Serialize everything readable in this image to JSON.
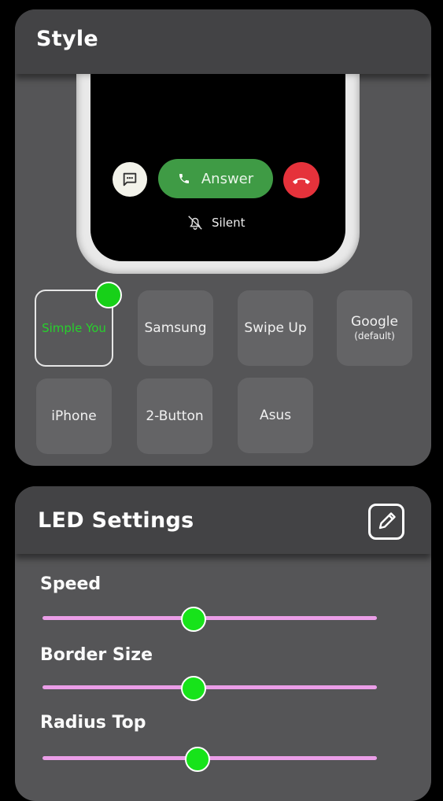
{
  "style_card": {
    "title": "Style",
    "preview": {
      "answer_label": "Answer",
      "silent_label": "Silent",
      "colors": {
        "answer": "#3f9b45",
        "decline": "#e5323b"
      }
    },
    "options": [
      {
        "label": "Simple You",
        "selected": true
      },
      {
        "label": "Samsung"
      },
      {
        "label": "Swipe Up"
      },
      {
        "label": "Google",
        "sublabel": "(default)"
      },
      {
        "label": "iPhone"
      },
      {
        "label": "2-Button"
      },
      {
        "label": "Asus"
      }
    ],
    "selected_color": "#27d12c"
  },
  "led_card": {
    "title": "LED Settings",
    "edit_icon": "edit-icon",
    "sliders": [
      {
        "label": "Speed",
        "value": 0.45
      },
      {
        "label": "Border Size",
        "value": 0.45
      },
      {
        "label": "Radius Top",
        "value": 0.46
      }
    ],
    "track_color": "#eb9ee8",
    "thumb_color": "#17e31a"
  }
}
